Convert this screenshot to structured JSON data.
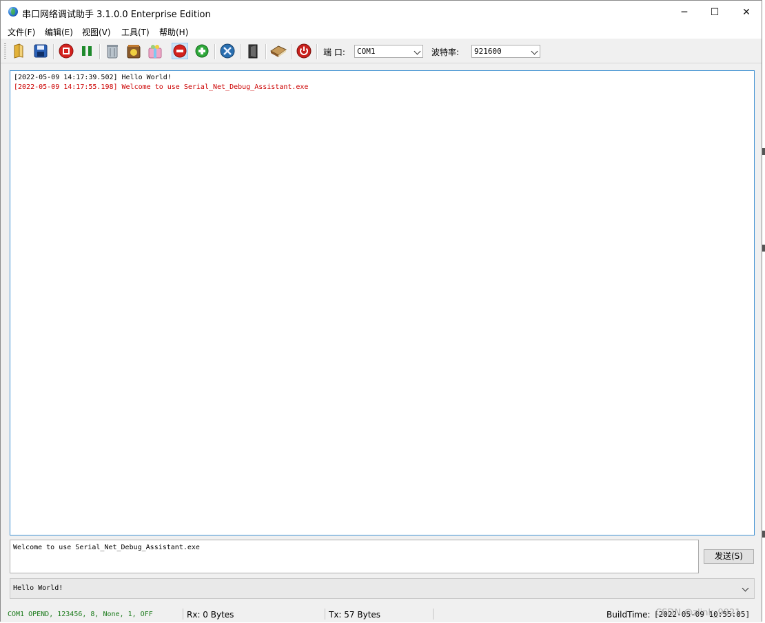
{
  "window": {
    "title": "串口网络调试助手 3.1.0.0 Enterprise Edition",
    "minimize": "─",
    "maximize": "☐",
    "close": "✕"
  },
  "menu": [
    {
      "label": "文件(F)"
    },
    {
      "label": "编辑(E)"
    },
    {
      "label": "视图(V)"
    },
    {
      "label": "工具(T)"
    },
    {
      "label": "帮助(H)"
    }
  ],
  "toolbar": {
    "icons": [
      "open-folder-icon",
      "save-icon",
      "stop-icon",
      "pause-icon",
      "trash-icon",
      "recycle-icon",
      "gift-icon",
      "remove-icon",
      "add-icon",
      "settings-icon",
      "door-icon",
      "book-icon",
      "power-icon"
    ],
    "port_label": "端 口:",
    "port_value": "COM1",
    "baud_label": "波特率:",
    "baud_value": "921600"
  },
  "log": {
    "lines": [
      {
        "text": "[2022-05-09 14:17:39.502] Hello World!",
        "color": "#000000"
      },
      {
        "text": "[2022-05-09 14:17:55.198] Welcome to use Serial_Net_Debug_Assistant.exe",
        "color": "#cc0000"
      }
    ]
  },
  "send": {
    "input_value": "Welcome to use Serial_Net_Debug_Assistant.exe",
    "button_label": "发送(S)"
  },
  "history": {
    "value": "Hello World!"
  },
  "status": {
    "port_status": "COM1 OPEND, 123456, 8, None, 1, OFF",
    "rx": "Rx: 0 Bytes",
    "tx": "Tx: 57 Bytes",
    "build_label": "BuildTime:",
    "build_time": "[2022-05-09 10:55:05]",
    "watermark": "CSDN @zlink_9921"
  },
  "colors": {
    "log_border": "#3c8fd2",
    "port_status": "#1a7a1a",
    "log_highlight": "#cc0000"
  }
}
